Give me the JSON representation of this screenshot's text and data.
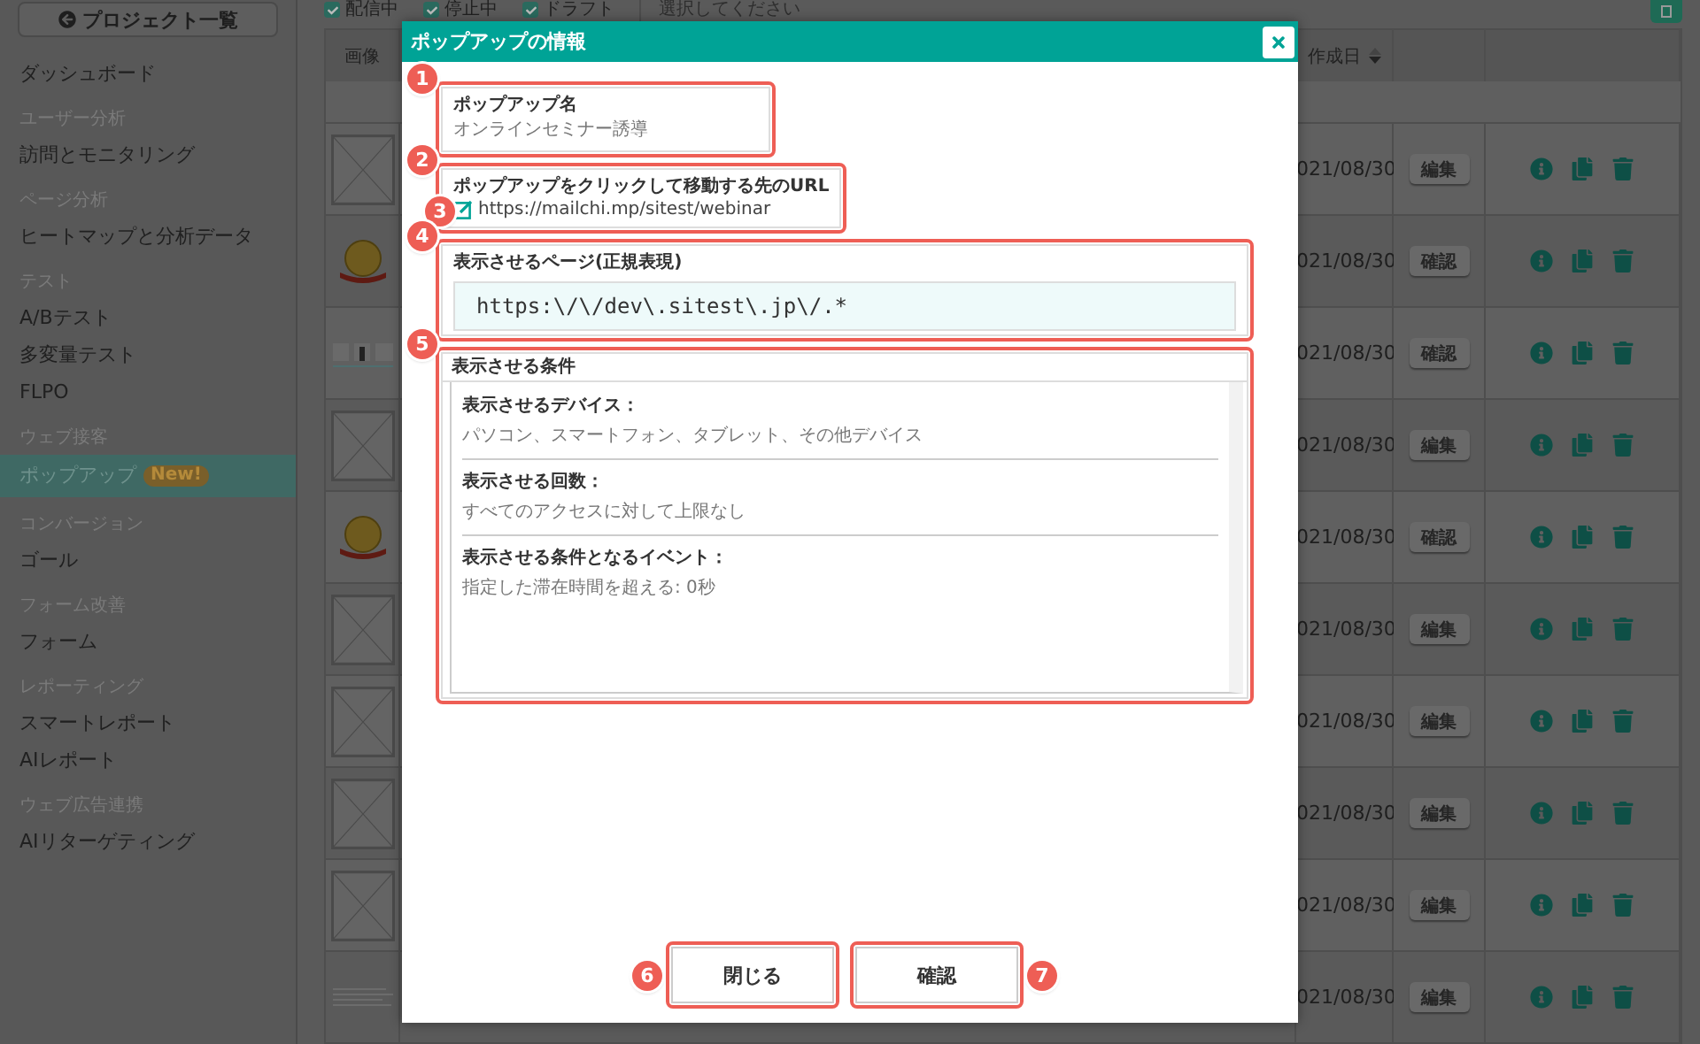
{
  "sidebar": {
    "top_button": "プロジェクト一覧",
    "sections": [
      {
        "items": [
          {
            "label": "ダッシュボード",
            "selected": false
          }
        ]
      },
      {
        "heading": "ユーザー分析",
        "items": [
          {
            "label": "訪問とモニタリング",
            "selected": false
          }
        ]
      },
      {
        "heading": "ページ分析",
        "items": [
          {
            "label": "ヒートマップと分析データ",
            "selected": false
          }
        ]
      },
      {
        "heading": "テスト",
        "items": [
          {
            "label": "A/Bテスト",
            "selected": false
          },
          {
            "label": "多変量テスト",
            "selected": false
          },
          {
            "label": "FLPO",
            "selected": false
          }
        ]
      },
      {
        "heading": "ウェブ接客",
        "items": [
          {
            "label": "ポップアップ",
            "selected": true,
            "badge": "New!"
          }
        ]
      },
      {
        "heading": "コンバージョン",
        "items": [
          {
            "label": "ゴール",
            "selected": false
          }
        ]
      },
      {
        "heading": "フォーム改善",
        "items": [
          {
            "label": "フォーム",
            "selected": false
          }
        ]
      },
      {
        "heading": "レポーティング",
        "items": [
          {
            "label": "スマートレポート",
            "selected": false
          },
          {
            "label": "AIレポート",
            "selected": false
          }
        ]
      },
      {
        "heading": "ウェブ広告連携",
        "items": [
          {
            "label": "AIリターゲティング",
            "selected": false
          }
        ]
      }
    ]
  },
  "filters": [
    {
      "label": "配信中",
      "checked": true
    },
    {
      "label": "停止中",
      "checked": true
    },
    {
      "label": "ドラフト",
      "checked": true
    }
  ],
  "filter_select": {
    "placeholder": "選択してください"
  },
  "table": {
    "columns": [
      {
        "label": "画像",
        "sortable": false
      },
      {
        "label": "作成日",
        "sortable": true
      }
    ],
    "rows": [
      {
        "kind": "placeholder",
        "date": "021/08/30",
        "action": "編集"
      },
      {
        "kind": "badge",
        "date": "021/08/30",
        "action": "確認"
      },
      {
        "kind": "screenshot",
        "date": "021/08/30",
        "action": "確認"
      },
      {
        "kind": "placeholder",
        "date": "021/08/30",
        "action": "編集"
      },
      {
        "kind": "badge",
        "date": "021/08/30",
        "action": "確認"
      },
      {
        "kind": "placeholder",
        "date": "021/08/30",
        "action": "編集"
      },
      {
        "kind": "placeholder",
        "date": "021/08/30",
        "action": "編集"
      },
      {
        "kind": "placeholder",
        "date": "021/08/30",
        "action": "編集"
      },
      {
        "kind": "placeholder",
        "date": "021/08/30",
        "action": "編集"
      },
      {
        "kind": "text",
        "date": "021/08/30",
        "action": "編集"
      }
    ]
  },
  "modal": {
    "title": "ポップアップの情報",
    "fields": [
      {
        "kind": "text",
        "label": "ポップアップ名",
        "value": "オンラインセミナー誘導",
        "marker": "1"
      },
      {
        "kind": "link",
        "label": "ポップアップをクリックして移動する先のURL",
        "value": "https://mailchi.mp/sitest/webinar",
        "marker": "2",
        "icon_marker": "3"
      },
      {
        "kind": "code",
        "label": "表示させるページ(正規表現)",
        "value": "https:\\/\\/dev\\.sitest\\.jp\\/.*",
        "marker": "4"
      },
      {
        "kind": "conditions",
        "label": "表示させる条件",
        "marker": "5",
        "items": [
          {
            "label": "表示させるデバイス：",
            "value": "パソコン、スマートフォン、タブレット、その他デバイス"
          },
          {
            "label": "表示させる回数：",
            "value": "すべてのアクセスに対して上限なし"
          },
          {
            "label": "表示させる条件となるイベント：",
            "value": "指定した滞在時間を超える: 0秒"
          }
        ]
      }
    ],
    "buttons": [
      {
        "label": "閉じる",
        "marker": "6"
      },
      {
        "label": "確認",
        "marker": "7"
      }
    ]
  }
}
